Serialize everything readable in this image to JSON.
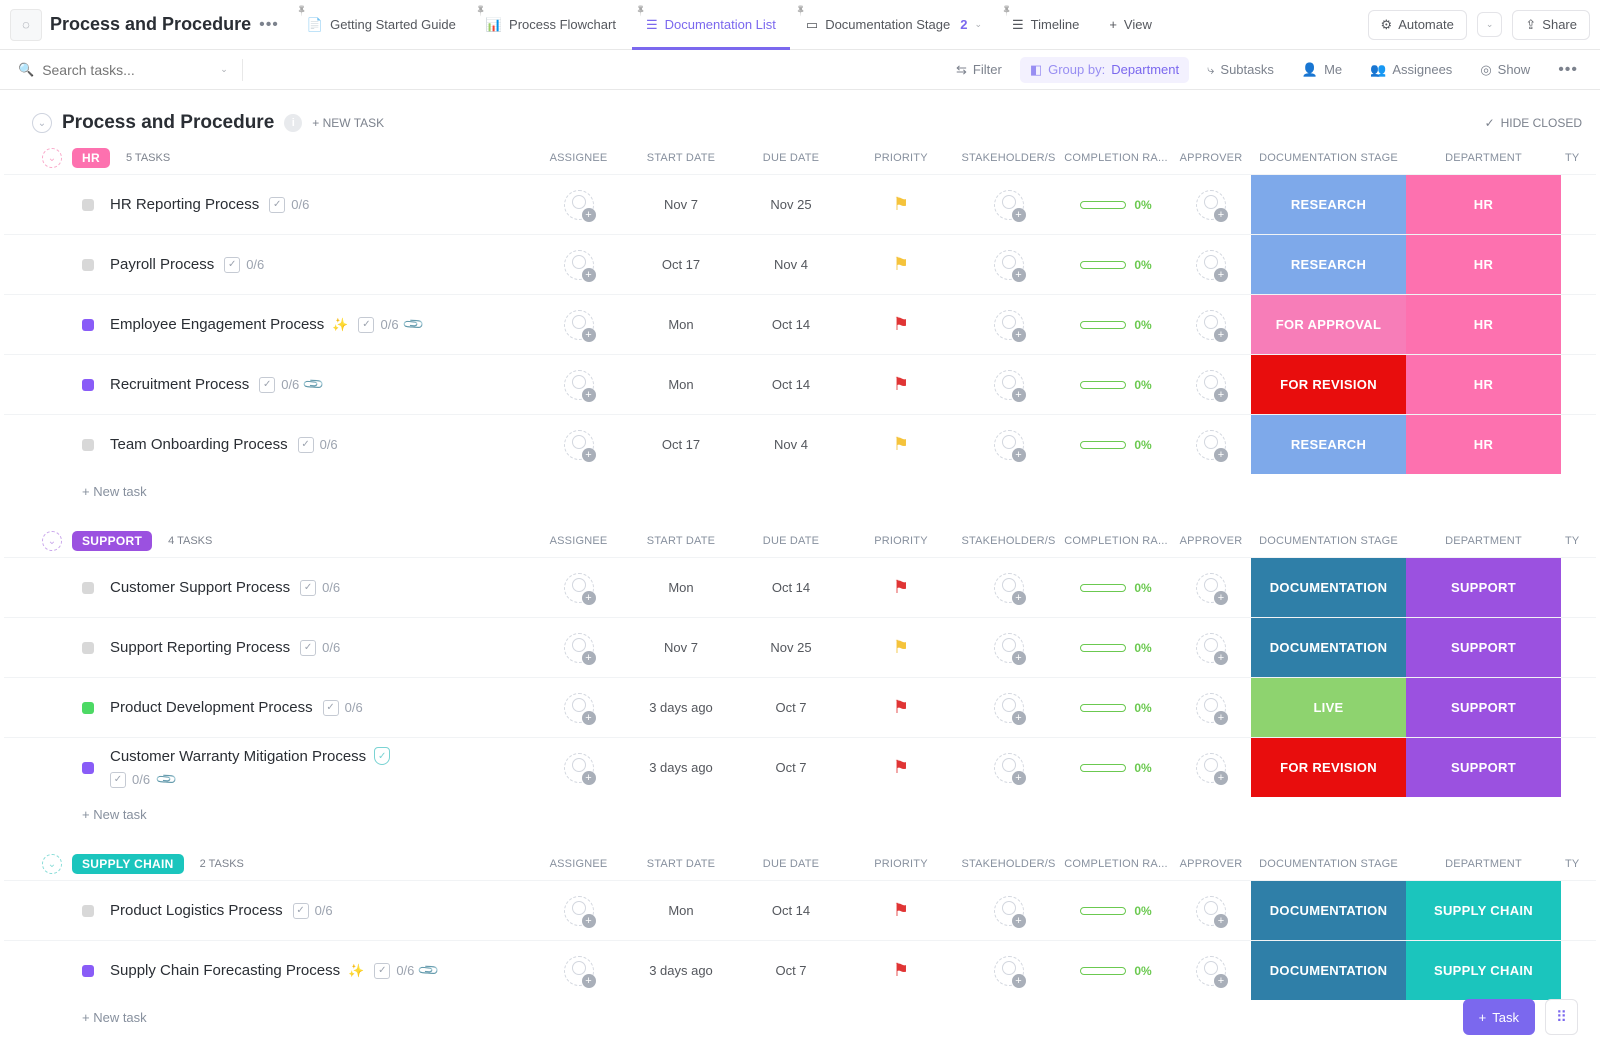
{
  "header": {
    "title": "Process and Procedure",
    "tabs": [
      {
        "label": "Getting Started Guide",
        "icon": "📄"
      },
      {
        "label": "Process Flowchart",
        "icon": "📊"
      },
      {
        "label": "Documentation List",
        "icon": "☰",
        "active": true
      },
      {
        "label": "Documentation Stage",
        "icon": "▭",
        "badge": "2",
        "chev": true
      },
      {
        "label": "Timeline",
        "icon": "☰"
      }
    ],
    "view_btn": "View",
    "automate_btn": "Automate",
    "share_btn": "Share"
  },
  "filter": {
    "search_placeholder": "Search tasks...",
    "filter": "Filter",
    "groupby_label": "Group by:",
    "groupby_value": "Department",
    "subtasks": "Subtasks",
    "me": "Me",
    "assignees": "Assignees",
    "show": "Show"
  },
  "list": {
    "name": "Process and Procedure",
    "new_task": "+ NEW TASK",
    "hide_closed": "HIDE CLOSED"
  },
  "columns": {
    "assignee": "ASSIGNEE",
    "start": "START DATE",
    "due": "DUE DATE",
    "pri": "PRIORITY",
    "stake": "STAKEHOLDER/S",
    "comp": "COMPLETION RA...",
    "appr": "APPROVER",
    "stage": "DOCUMENTATION STAGE",
    "dept": "DEPARTMENT",
    "ty": "TY"
  },
  "groups": [
    {
      "name": "HR",
      "color": "#fd71af",
      "chev": "#f9a8c9",
      "count": "5 TASKS",
      "tasks": [
        {
          "name": "HR Reporting Process",
          "sq": "#d8d8d8",
          "sub": "0/6",
          "start": "Nov 7",
          "due": "Nov 25",
          "flag": "#f5c33b",
          "comp": "0%",
          "stage": "RESEARCH",
          "stageC": "#7ea9ea",
          "dept": "HR",
          "deptC": "#fd71af"
        },
        {
          "name": "Payroll Process",
          "sq": "#d8d8d8",
          "sub": "0/6",
          "start": "Oct 17",
          "due": "Nov 4",
          "flag": "#f5c33b",
          "comp": "0%",
          "stage": "RESEARCH",
          "stageC": "#7ea9ea",
          "dept": "HR",
          "deptC": "#fd71af"
        },
        {
          "name": "Employee Engagement Process",
          "sq": "#895cf7",
          "spark": true,
          "sub": "0/6",
          "clip": true,
          "start": "Mon",
          "due": "Oct 14",
          "flag": "#e03535",
          "comp": "0%",
          "stage": "FOR APPROVAL",
          "stageC": "#f77db8",
          "dept": "HR",
          "deptC": "#fd71af"
        },
        {
          "name": "Recruitment Process",
          "sq": "#895cf7",
          "sub": "0/6",
          "clip": true,
          "start": "Mon",
          "due": "Oct 14",
          "flag": "#e03535",
          "comp": "0%",
          "stage": "FOR REVISION",
          "stageC": "#e80d0d",
          "dept": "HR",
          "deptC": "#fd71af"
        },
        {
          "name": "Team Onboarding Process",
          "sq": "#d8d8d8",
          "sub": "0/6",
          "start": "Oct 17",
          "due": "Nov 4",
          "flag": "#f5c33b",
          "comp": "0%",
          "stage": "RESEARCH",
          "stageC": "#7ea9ea",
          "dept": "HR",
          "deptC": "#fd71af"
        }
      ]
    },
    {
      "name": "SUPPORT",
      "color": "#9b51e0",
      "chev": "#c9a6eb",
      "count": "4 TASKS",
      "tasks": [
        {
          "name": "Customer Support Process",
          "sq": "#d8d8d8",
          "sub": "0/6",
          "start": "Mon",
          "due": "Oct 14",
          "flag": "#e03535",
          "comp": "0%",
          "stage": "DOCUMENTATION",
          "stageC": "#2f7fa8",
          "dept": "SUPPORT",
          "deptC": "#9b51e0"
        },
        {
          "name": "Support Reporting Process",
          "sq": "#d8d8d8",
          "sub": "0/6",
          "start": "Nov 7",
          "due": "Nov 25",
          "flag": "#f5c33b",
          "comp": "0%",
          "stage": "DOCUMENTATION",
          "stageC": "#2f7fa8",
          "dept": "SUPPORT",
          "deptC": "#9b51e0"
        },
        {
          "name": "Product Development Process",
          "sq": "#4cd964",
          "sub": "0/6",
          "start": "3 days ago",
          "due": "Oct 7",
          "flag": "#e03535",
          "comp": "0%",
          "stage": "LIVE",
          "stageC": "#8ed36f",
          "dept": "SUPPORT",
          "deptC": "#9b51e0"
        },
        {
          "name": "Customer Warranty Mitigation Process",
          "sq": "#895cf7",
          "shield": true,
          "sub": "0/6",
          "clip": true,
          "start": "3 days ago",
          "due": "Oct 7",
          "flag": "#e03535",
          "comp": "0%",
          "stage": "FOR REVISION",
          "stageC": "#e80d0d",
          "dept": "SUPPORT",
          "deptC": "#9b51e0",
          "wrap": true
        }
      ]
    },
    {
      "name": "SUPPLY CHAIN",
      "color": "#1bc5bd",
      "chev": "#86dcd7",
      "count": "2 TASKS",
      "tasks": [
        {
          "name": "Product Logistics Process",
          "sq": "#d8d8d8",
          "sub": "0/6",
          "start": "Mon",
          "due": "Oct 14",
          "flag": "#e03535",
          "comp": "0%",
          "stage": "DOCUMENTATION",
          "stageC": "#2f7fa8",
          "dept": "SUPPLY CHAIN",
          "deptC": "#1bc5bd"
        },
        {
          "name": "Supply Chain Forecasting Process",
          "sq": "#895cf7",
          "spark": true,
          "sub": "0/6",
          "clip": true,
          "start": "3 days ago",
          "due": "Oct 7",
          "flag": "#e03535",
          "comp": "0%",
          "stage": "DOCUMENTATION",
          "stageC": "#2f7fa8",
          "dept": "SUPPLY CHAIN",
          "deptC": "#1bc5bd"
        }
      ]
    }
  ],
  "newtask_row": "+ New task",
  "fab": {
    "task": "Task"
  }
}
